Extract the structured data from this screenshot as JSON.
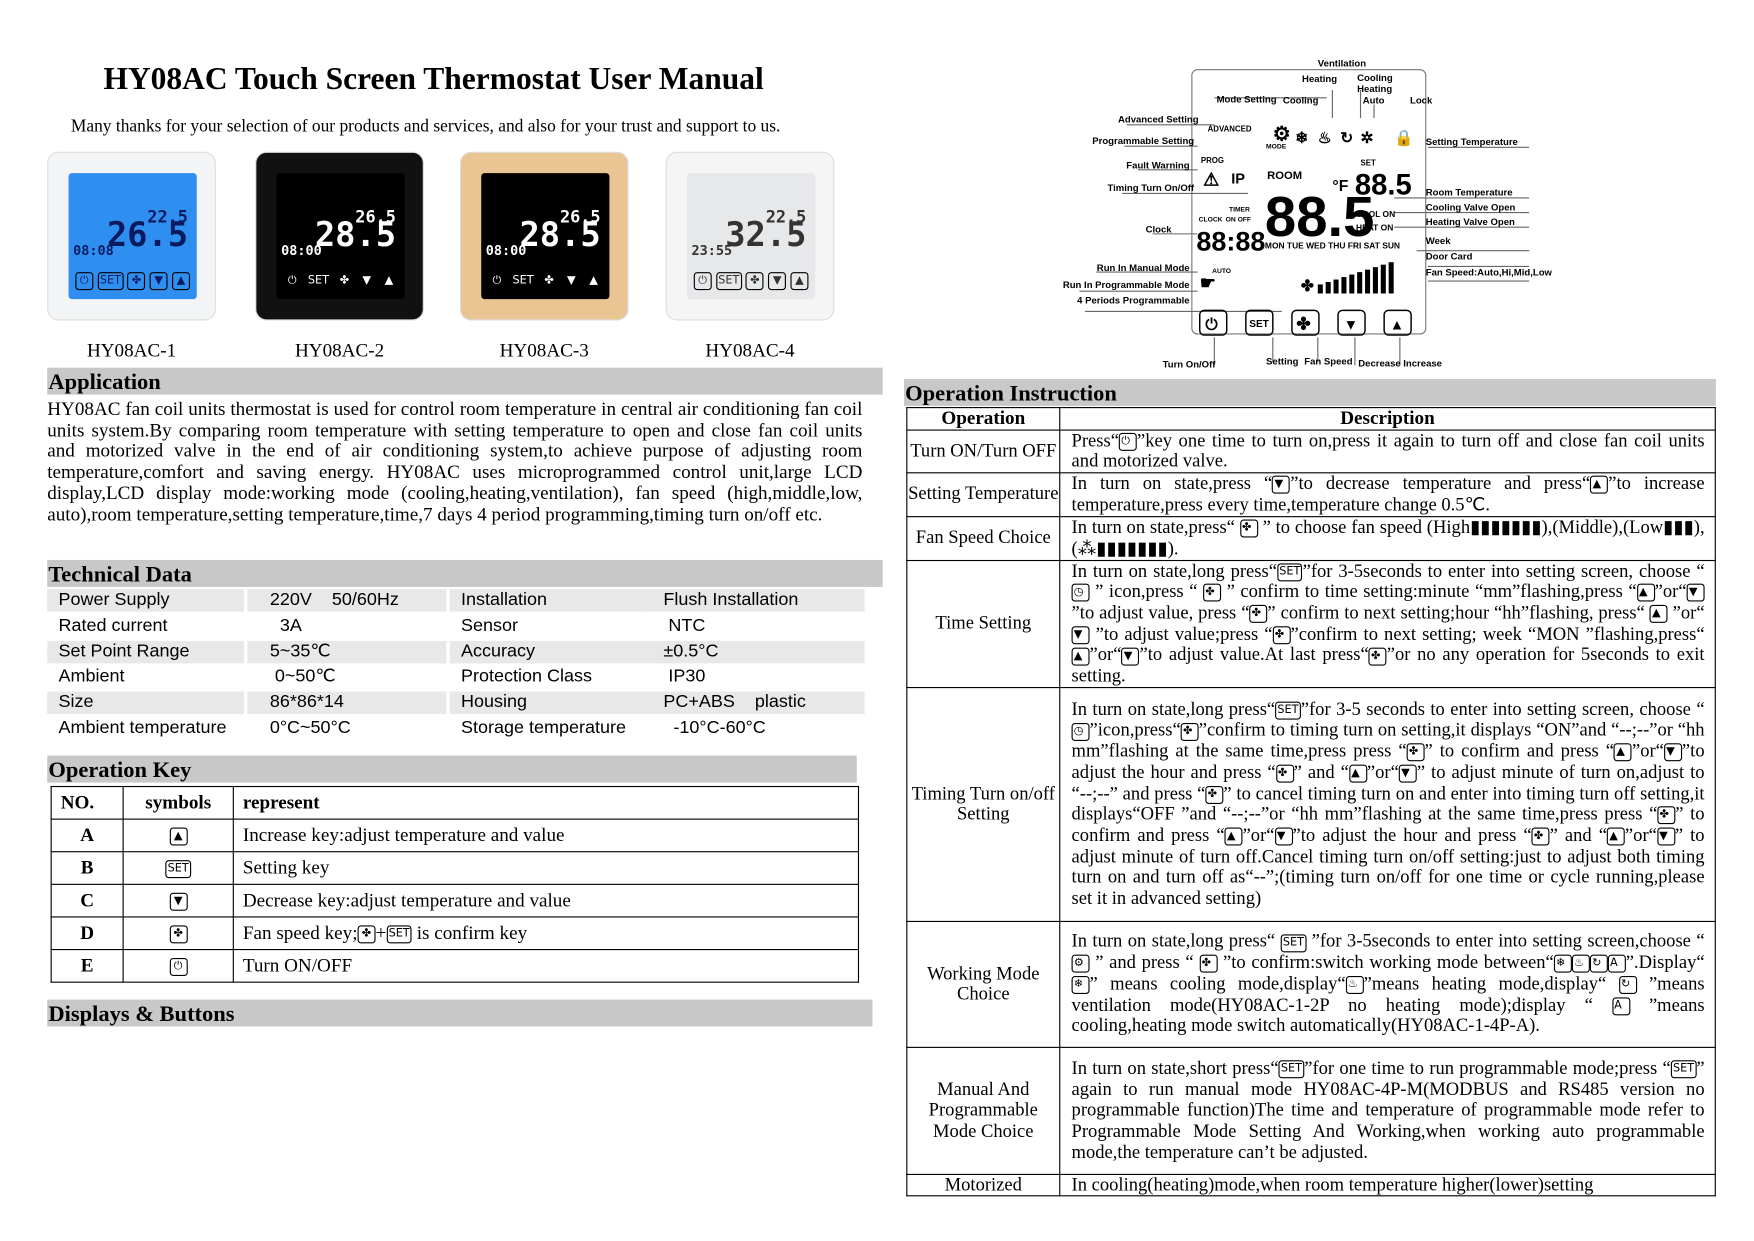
{
  "title": "HY08AC Touch Screen Thermostat User Manual",
  "intro": "Many thanks for your selection of our products and services, and also for your trust and support to us.",
  "products": [
    {
      "label": "HY08AC-1",
      "room": "26.5",
      "set": "22.5",
      "time": "08:08",
      "screen": "#2f8ff0",
      "body": "#f2f4f6",
      "ink": "#0a1a60"
    },
    {
      "label": "HY08AC-2",
      "room": "28.5",
      "set": "26.5",
      "time": "08:00",
      "screen": "#000000",
      "body": "#111111",
      "ink": "#ffffff"
    },
    {
      "label": "HY08AC-3",
      "room": "28.5",
      "set": "26.5",
      "time": "08:00",
      "screen": "#000000",
      "body": "#e8c592",
      "ink": "#ffffff"
    },
    {
      "label": "HY08AC-4",
      "room": "32.5",
      "set": "22.5",
      "time": "23:55",
      "screen": "#e6e8ea",
      "body": "#f5f5f5",
      "ink": "#333333"
    }
  ],
  "application": {
    "heading": "Application",
    "text": "HY08AC fan coil units thermostat is used for control room temperature in central air conditioning fan coil units system.By comparing room temperature with setting temperature to open and close fan coil units and motorized valve in the end of air conditioning system,to achieve  purpose of adjusting room temperature,comfort and saving energy. HY08AC uses microprogrammed control unit,large LCD display,LCD display mode:working mode (cooling,heating,ventilation), fan speed (high,middle,low, auto),room temperature,setting temperature,time,7 days 4 period programming,timing turn on/off etc."
  },
  "technical": {
    "heading": "Technical Data",
    "rows": [
      [
        "Power Supply",
        "220V    50/60Hz",
        "Installation",
        "Flush Installation"
      ],
      [
        "Rated current",
        "  3A",
        "Sensor",
        " NTC"
      ],
      [
        "Set Point Range",
        "5~35℃",
        "Accuracy",
        "±0.5°C"
      ],
      [
        "Ambient",
        " 0~50℃",
        "Protection Class",
        " IP30"
      ],
      [
        "Size",
        "86*86*14",
        "Housing",
        "PC+ABS    plastic"
      ],
      [
        "Ambient temperature",
        "0°C~50°C",
        "Storage temperature",
        "  -10°C-60°C"
      ]
    ]
  },
  "operation_key": {
    "heading": "Operation Key",
    "headers": [
      "NO.",
      "symbols",
      "represent"
    ],
    "rows": [
      {
        "no": "A",
        "icon": "up-arrow",
        "glyph": "▲",
        "text": "Increase key:adjust temperature and value"
      },
      {
        "no": "B",
        "icon": "set",
        "glyph": "SET",
        "text": "Setting key"
      },
      {
        "no": "C",
        "icon": "down-arrow",
        "glyph": "▼",
        "text": "Decrease key:adjust temperature and value"
      },
      {
        "no": "D",
        "icon": "fan",
        "glyph": "✤",
        "text": "Fan speed key;",
        "extra": "+",
        "extra2": " is confirm key"
      },
      {
        "no": "E",
        "icon": "power",
        "glyph": "⏻",
        "text": "Turn ON/OFF"
      }
    ]
  },
  "displays_heading": "Displays & Buttons",
  "lcd_labels": {
    "ventilation": "Ventilation",
    "heating": "Heating",
    "cooling_heating_auto": [
      "Cooling",
      "Heating",
      "Auto"
    ],
    "mode_setting": "Mode Setting",
    "cooling": "Cooling",
    "lock": "Lock",
    "advanced_setting": "Advanced Setting",
    "programmable_setting": "Programmable Setting",
    "fault_warning": "Fault Warning",
    "timing": "Timing Turn On/Off",
    "clock": "Clock",
    "manual": "Run In Manual Mode",
    "prog_mode": "Run In Programmable Mode",
    "periods": "4 Periods Programmable",
    "setting_temp": "Setting Temperature",
    "room_temp": "Room Temperature",
    "cool_valve": "Cooling Valve Open",
    "heat_valve": "Heating Valve Open",
    "week": "Week",
    "door_card": "Door Card",
    "fan_speed": "Fan Speed:Auto,Hi,Mid,Low",
    "turn": "Turn On/Off",
    "setting": "Setting",
    "fanspeed_btn": "Fan Speed",
    "decrease": "Decrease",
    "increase": "Increase",
    "lcd_text": {
      "advanced": "ADVANCED",
      "prog": "PROG",
      "mode": "MODE",
      "room": "ROOM",
      "set": "SET",
      "big": "88.5",
      "small": "88.5",
      "clock": "CLOCK",
      "timer": "TIMER",
      "onoff": "ON OFF",
      "time": "88:88",
      "ip": "IP",
      "cool_on": "COOL ON",
      "heat_on": "HEAT ON",
      "days": "MON TUE WED THU FRI  SAT SUN",
      "auto": "AUTO",
      "f": "°F",
      "set_btn": "SET"
    }
  },
  "operation_instruction": {
    "heading": "Operation Instruction",
    "headers": [
      "Operation",
      "Description"
    ],
    "rows": [
      {
        "op": "Turn ON/Turn OFF",
        "desc": "Press“{power}”key one time to turn on,press it again to turn off and close fan coil units and motorized valve."
      },
      {
        "op": "Setting Temperature",
        "desc": "In turn on state,press “{down}”to decrease temperature and press“{up}”to increase temperature,press every time,temperature change 0.5℃."
      },
      {
        "op": "Fan Speed Choice",
        "desc": "In turn on state,press“ {fan} ” to choose fan speed (High▮▮▮▮▮▮▮),(Middle),(Low▮▮▮),(⁂▮▮▮▮▮▮▮)."
      },
      {
        "op": "Time Setting",
        "desc": "In turn on state,long press“{set}”for 3-5seconds to enter into setting screen, choose “ {clock} ” icon,press “ {fan} ” confirm to time setting:minute “mm”flashing,press “{up}”or“{down}”to adjust value, press “{fan}” confirm to next setting;hour “hh”flashing, press“ {up} ”or“ {down} ”to adjust value;press “{fan}”confirm to next setting; week “MON ”flashing,press“{up}”or“{down}”to adjust value.At last press“{fan}”or no any operation for 5seconds to exit setting."
      },
      {
        "op": "Timing Turn on/off Setting",
        "desc": "In turn on state,long press“{set}”for 3-5 seconds to enter into setting screen, choose “{clock}”icon,press“{fan}”confirm to timing turn on setting,it displays “ON”and “--;--”or “hh mm”flashing at the same time,press press “{fan}” to confirm and press “{up}”or“{down}”to adjust the hour and press “{fan}” and “{up}”or“{down}” to adjust minute of turn on,adjust to “--;--” and press “{fan}” to cancel timing turn on and enter into timing turn off setting,it displays“OFF ”and “--;--”or “hh mm”flashing at the same time,press press “{fan}” to confirm and press “{up}”or“{down}”to adjust the hour and press “{fan}” and “{up}”or“{down}” to adjust minute of turn off.Cancel timing turn on/off setting:just to adjust both timing turn on and turn off as“--”;(timing turn on/off for one time or cycle running,please set it in advanced setting)"
      },
      {
        "op": "Working Mode Choice",
        "desc": "In turn on state,long press“ {set} ”for 3-5seconds to enter into setting screen,choose “ {mode} ” and press “ {fan} ”to confirm:switch working mode between“{cool}{heat}{vent}{auto}”.Display“{cool}” means cooling mode,display“{heat}”means heating mode,display“ {vent} ”means ventilation mode(HY08AC-1-2P no heating mode);display “ {auto} ”means cooling,heating mode switch automatically(HY08AC-1-4P-A)."
      },
      {
        "op": "Manual And Programmable Mode Choice",
        "desc": "In turn on state,short press“{set}”for one time to run programmable mode;press “{set}” again to run manual mode HY08AC-4P-M(MODBUS and RS485 version no programmable function)The time and temperature of programmable mode refer to Programmable Mode Setting And Working,when working auto programmable mode,the temperature can’t be adjusted."
      },
      {
        "op": "Motorized",
        "desc": "In cooling(heating)mode,when room temperature higher(lower)setting"
      }
    ]
  },
  "icons": {
    "power": "⏻",
    "up": "▲",
    "down": "▼",
    "set": "SET",
    "fan": "✤",
    "clock": "◷",
    "mode": "⚙",
    "cool": "❄",
    "heat": "♨",
    "vent": "↻",
    "auto": "A"
  }
}
